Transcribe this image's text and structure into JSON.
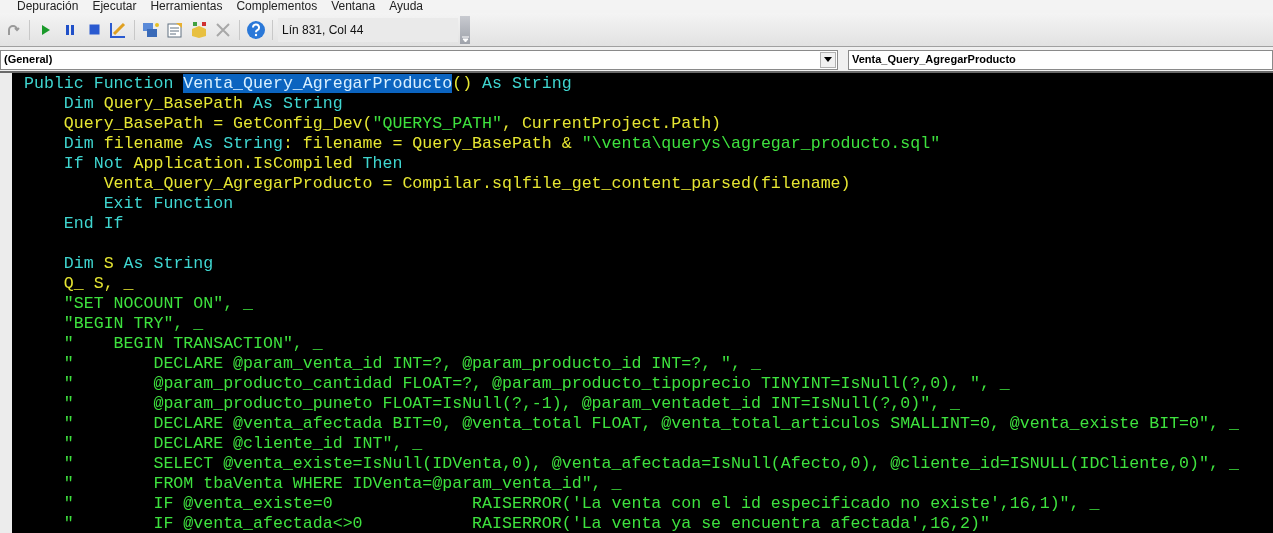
{
  "menu_bar": {
    "items": [
      "Depuración",
      "Ejecutar",
      "Herramientas",
      "Complementos",
      "Ventana",
      "Ayuda"
    ]
  },
  "toolbar": {
    "position": "Lín 831, Col 44"
  },
  "object_combo": {
    "value": "(General)"
  },
  "procedure_combo": {
    "value": "Venta_Query_AgregarProducto"
  },
  "code_lines": [
    {
      "kind": "code",
      "tokens": [
        {
          "kind": "keyword",
          "text": "Public Function "
        },
        {
          "kind": "selection",
          "text": "Venta_Query_AgregarProducto"
        },
        {
          "kind": "code",
          "text": "() "
        },
        {
          "kind": "keyword",
          "text": "As String"
        }
      ]
    },
    {
      "kind": "code",
      "tokens": [
        {
          "kind": "keyword",
          "text": "    Dim "
        },
        {
          "kind": "code",
          "text": "Query_BasePath "
        },
        {
          "kind": "keyword",
          "text": "As String"
        }
      ]
    },
    {
      "kind": "code",
      "tokens": [
        {
          "kind": "code",
          "text": "    Query_BasePath = GetConfig_Dev("
        },
        {
          "kind": "string",
          "text": "\"QUERYS_PATH\""
        },
        {
          "kind": "code",
          "text": ", CurrentProject.Path)"
        }
      ]
    },
    {
      "kind": "code",
      "tokens": [
        {
          "kind": "keyword",
          "text": "    Dim "
        },
        {
          "kind": "code",
          "text": "filename "
        },
        {
          "kind": "keyword",
          "text": "As String"
        },
        {
          "kind": "code",
          "text": ": filename = Query_BasePath & "
        },
        {
          "kind": "string",
          "text": "\"\\venta\\querys\\agregar_producto.sql\""
        }
      ]
    },
    {
      "kind": "code",
      "tokens": [
        {
          "kind": "keyword",
          "text": "    If Not "
        },
        {
          "kind": "code",
          "text": "Application.IsCompiled "
        },
        {
          "kind": "keyword",
          "text": "Then"
        }
      ]
    },
    {
      "kind": "code",
      "tokens": [
        {
          "kind": "code",
          "text": "        Venta_Query_AgregarProducto = Compilar.sqlfile_get_content_parsed(filename)"
        }
      ]
    },
    {
      "kind": "code",
      "tokens": [
        {
          "kind": "keyword",
          "text": "        Exit Function"
        }
      ]
    },
    {
      "kind": "code",
      "tokens": [
        {
          "kind": "keyword",
          "text": "    End If"
        }
      ]
    },
    {
      "kind": "blank"
    },
    {
      "kind": "code",
      "tokens": [
        {
          "kind": "keyword",
          "text": "    Dim "
        },
        {
          "kind": "code",
          "text": "S "
        },
        {
          "kind": "keyword",
          "text": "As String"
        }
      ]
    },
    {
      "kind": "code",
      "tokens": [
        {
          "kind": "code",
          "text": "    Q_ S, _"
        }
      ]
    },
    {
      "kind": "code",
      "tokens": [
        {
          "kind": "string",
          "text": "    \"SET NOCOUNT ON\", _"
        }
      ]
    },
    {
      "kind": "code",
      "tokens": [
        {
          "kind": "string",
          "text": "    \"BEGIN TRY\", _"
        }
      ]
    },
    {
      "kind": "code",
      "tokens": [
        {
          "kind": "string",
          "text": "    \"    BEGIN TRANSACTION\", _"
        }
      ]
    },
    {
      "kind": "code",
      "tokens": [
        {
          "kind": "string",
          "text": "    \"        DECLARE @param_venta_id INT=?, @param_producto_id INT=?, \", _"
        }
      ]
    },
    {
      "kind": "code",
      "tokens": [
        {
          "kind": "string",
          "text": "    \"        @param_producto_cantidad FLOAT=?, @param_producto_tipoprecio TINYINT=IsNull(?,0), \", _"
        }
      ]
    },
    {
      "kind": "code",
      "tokens": [
        {
          "kind": "string",
          "text": "    \"        @param_producto_puneto FLOAT=IsNull(?,-1), @param_ventadet_id INT=IsNull(?,0)\", _"
        }
      ]
    },
    {
      "kind": "code",
      "tokens": [
        {
          "kind": "string",
          "text": "    \"        DECLARE @venta_afectada BIT=0, @venta_total FLOAT, @venta_total_articulos SMALLINT=0, @venta_existe BIT=0\", _"
        }
      ]
    },
    {
      "kind": "code",
      "tokens": [
        {
          "kind": "string",
          "text": "    \"        DECLARE @cliente_id INT\", _"
        }
      ]
    },
    {
      "kind": "code",
      "tokens": [
        {
          "kind": "string",
          "text": "    \"        SELECT @venta_existe=IsNull(IDVenta,0), @venta_afectada=IsNull(Afecto,0), @cliente_id=ISNULL(IDCliente,0)\", _"
        }
      ]
    },
    {
      "kind": "code",
      "tokens": [
        {
          "kind": "string",
          "text": "    \"        FROM tbaVenta WHERE IDVenta=@param_venta_id\", _"
        }
      ]
    },
    {
      "kind": "code",
      "tokens": [
        {
          "kind": "string",
          "text": "    \"        IF @venta_existe=0              RAISERROR('La venta con el id especificado no existe',16,1)\", _"
        }
      ]
    },
    {
      "kind": "code",
      "tokens": [
        {
          "kind": "string",
          "text": "    \"        IF @venta_afectada<>0           RAISERROR('La venta ya se encuentra afectada',16,2)\""
        }
      ]
    }
  ]
}
